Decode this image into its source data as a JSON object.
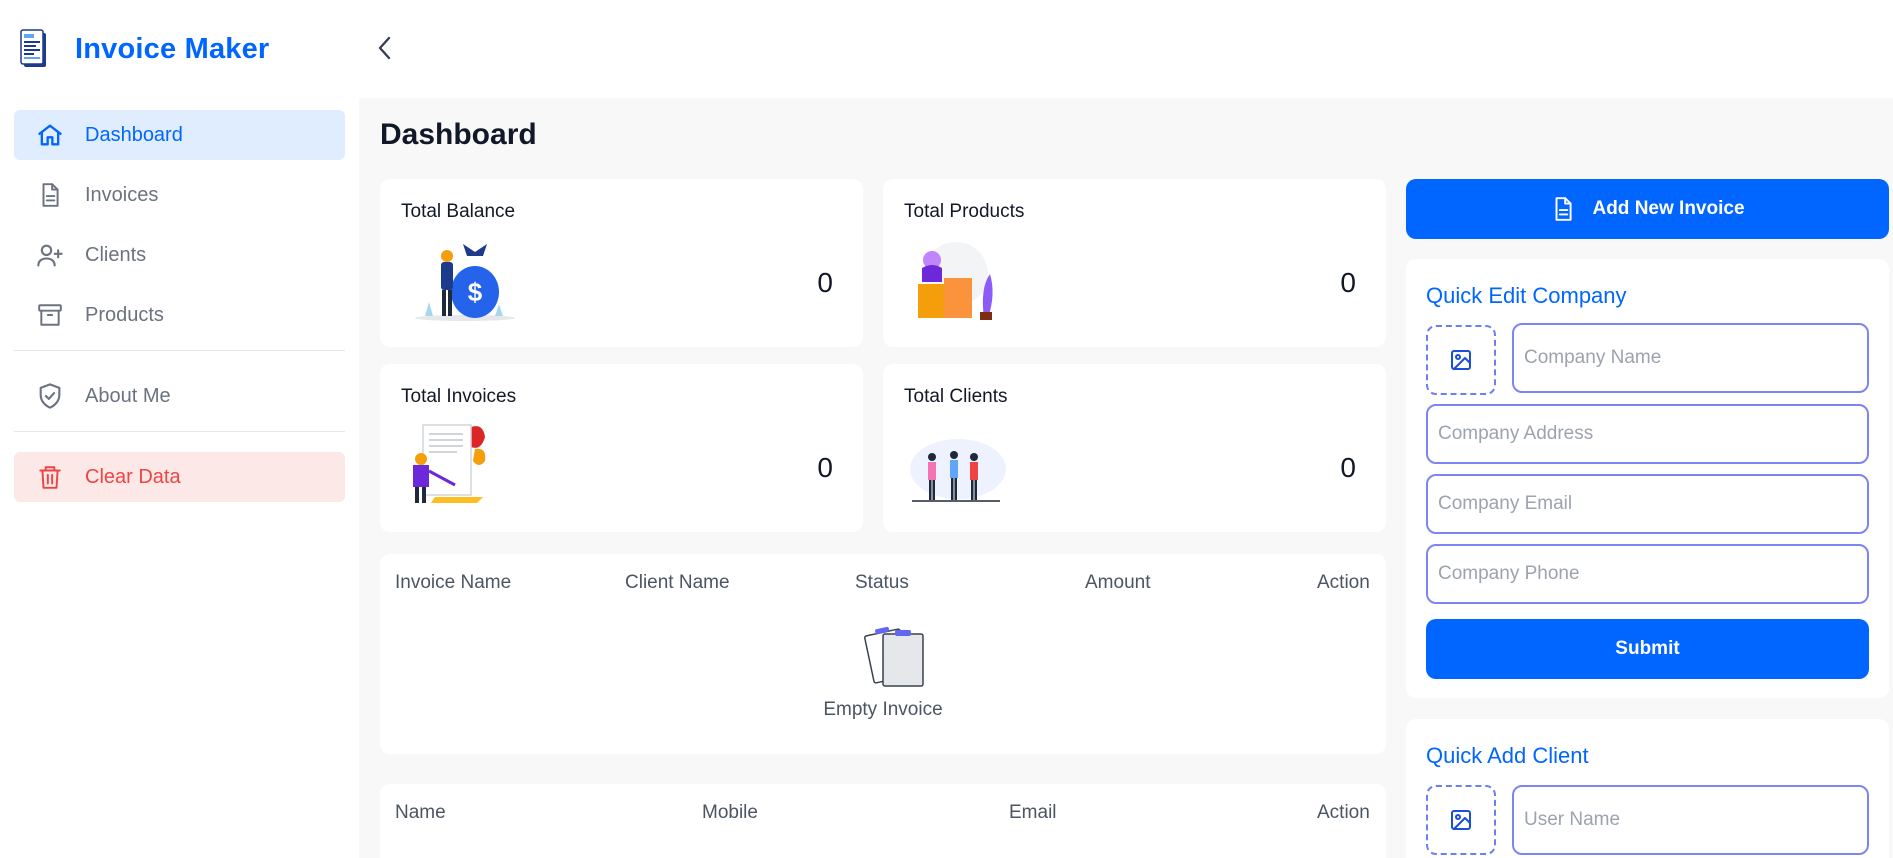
{
  "brand": {
    "title": "Invoice Maker",
    "logo_icon": "invoice-logo-icon"
  },
  "sidebar": {
    "items": [
      {
        "label": "Dashboard",
        "icon": "home-icon",
        "active": true
      },
      {
        "label": "Invoices",
        "icon": "document-icon"
      },
      {
        "label": "Clients",
        "icon": "user-plus-icon"
      },
      {
        "label": "Products",
        "icon": "archive-box-icon"
      },
      {
        "label": "About Me",
        "icon": "shield-check-icon"
      },
      {
        "label": "Clear Data",
        "icon": "trash-icon",
        "danger": true
      }
    ]
  },
  "topbar": {
    "collapse_icon": "chevron-left-icon"
  },
  "main": {
    "title": "Dashboard",
    "stats": [
      {
        "title": "Total Balance",
        "value": "0",
        "illustration": "money-bag-illustration"
      },
      {
        "title": "Total Products",
        "value": "0",
        "illustration": "boxes-illustration"
      },
      {
        "title": "Total Invoices",
        "value": "0",
        "illustration": "document-signing-illustration"
      },
      {
        "title": "Total Clients",
        "value": "0",
        "illustration": "people-meeting-illustration"
      }
    ],
    "invoice_table": {
      "columns": [
        "Invoice Name",
        "Client Name",
        "Status",
        "Amount",
        "Action"
      ],
      "rows": [],
      "empty_text": "Empty Invoice"
    },
    "client_table": {
      "columns": [
        "Name",
        "Mobile",
        "Email",
        "Action"
      ],
      "rows": []
    }
  },
  "right": {
    "add_invoice_label": "Add New Invoice",
    "quick_edit_company": {
      "title": "Quick Edit Company",
      "name_placeholder": "Company Name",
      "address_placeholder": "Company Address",
      "email_placeholder": "Company Email",
      "phone_placeholder": "Company Phone",
      "submit_label": "Submit"
    },
    "quick_add_client": {
      "title": "Quick Add Client",
      "name_placeholder": "User Name"
    }
  },
  "colors": {
    "accent": "#0066ff",
    "active_bg": "#e0edff",
    "danger": "#ef4444",
    "danger_bg": "#fde8e8",
    "input_border": "#7c86f0",
    "main_bg": "#f8f8f8"
  }
}
